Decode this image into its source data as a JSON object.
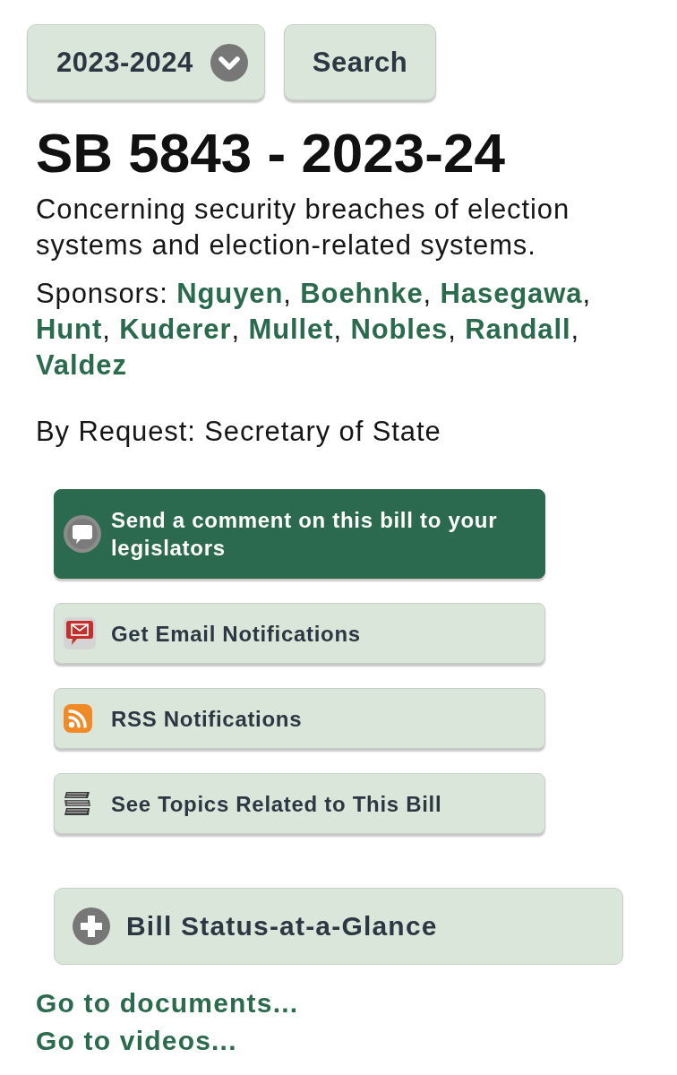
{
  "toolbar": {
    "session_select": {
      "value": "2023-2024"
    },
    "search_button": {
      "label": "Search"
    }
  },
  "bill": {
    "title": "SB 5843 - 2023-24",
    "description": "Concerning security breaches of election systems and election-related systems.",
    "sponsors": {
      "label": "Sponsors:",
      "separator": ",",
      "names": [
        "Nguyen",
        "Boehnke",
        "Hasegawa",
        "Hunt",
        "Kuderer",
        "Mullet",
        "Nobles",
        "Randall",
        "Valdez"
      ]
    },
    "by_request": "By Request: Secretary of State"
  },
  "actions": [
    {
      "kind": "comment",
      "label": "Send a comment on this bill to your legislators",
      "primary": true
    },
    {
      "kind": "email",
      "label": "Get Email Notifications",
      "primary": false
    },
    {
      "kind": "rss",
      "label": "RSS Notifications",
      "primary": false
    },
    {
      "kind": "topics",
      "label": "See Topics Related to This Bill",
      "primary": false
    }
  ],
  "status_panel": {
    "label": "Bill Status-at-a-Glance",
    "expanded": false
  },
  "links": [
    {
      "label": "Go to documents..."
    },
    {
      "label": "Go to videos..."
    }
  ]
}
